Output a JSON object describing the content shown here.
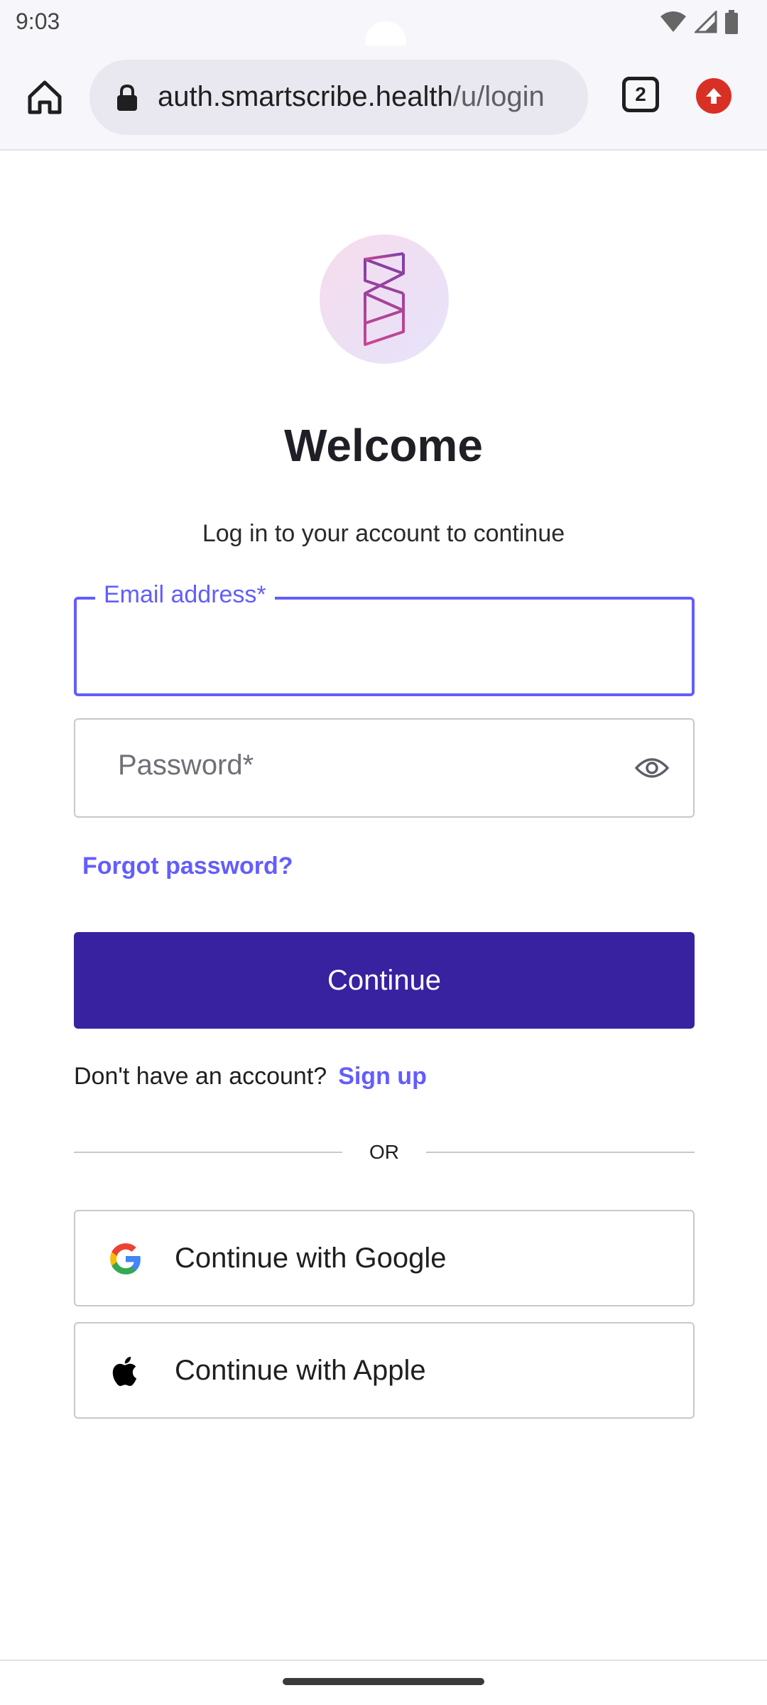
{
  "status_bar": {
    "time": "9:03",
    "icons": [
      "wifi-icon",
      "signal-icon",
      "battery-icon"
    ]
  },
  "browser": {
    "url_host": "auth.smartscribe.health",
    "url_path": "/u/login",
    "tab_count": "2",
    "icons": [
      "home-icon",
      "lock-icon",
      "tabs-icon",
      "update-icon"
    ],
    "update_color": "#d93025"
  },
  "page": {
    "logo_icon": "smartscribe-logo",
    "title": "Welcome",
    "subtitle": "Log in to your account to continue",
    "email_label": "Email address*",
    "email_value": "",
    "password_placeholder": "Password*",
    "password_toggle_icon": "eye-icon",
    "forgot_password": "Forgot password?",
    "continue_label": "Continue",
    "no_account_text": "Don't have an account?",
    "signup_link": "Sign up",
    "divider_text": "OR",
    "google_label": "Continue with Google",
    "apple_label": "Continue with Apple"
  },
  "colors": {
    "accent": "#635dff",
    "primary_button": "#3822a0",
    "border": "#c9c7cf"
  }
}
